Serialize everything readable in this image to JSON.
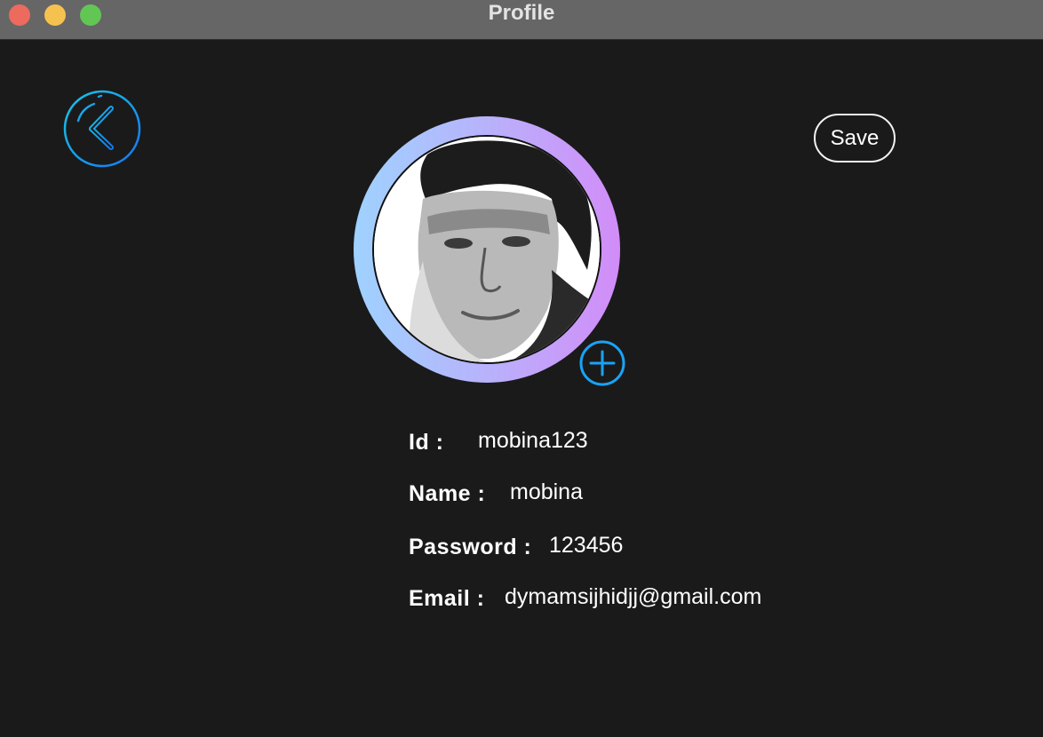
{
  "window": {
    "title": "Profile"
  },
  "toolbar": {
    "back_icon": "chevron-left-circle-icon",
    "save_label": "Save"
  },
  "avatar": {
    "ring_colors": [
      "#9fd2ff",
      "#b8b2fb",
      "#d28cf8"
    ],
    "add_icon": "plus-circle-icon",
    "accent": "#1aa3f5"
  },
  "profile": {
    "id_label": "Id :",
    "id_value": "mobina123",
    "name_label": "Name :",
    "name_value": "mobina",
    "password_label": "Password :",
    "password_value": "123456",
    "email_label": "Email :",
    "email_value": "dymamsijhidjj@gmail.com"
  }
}
